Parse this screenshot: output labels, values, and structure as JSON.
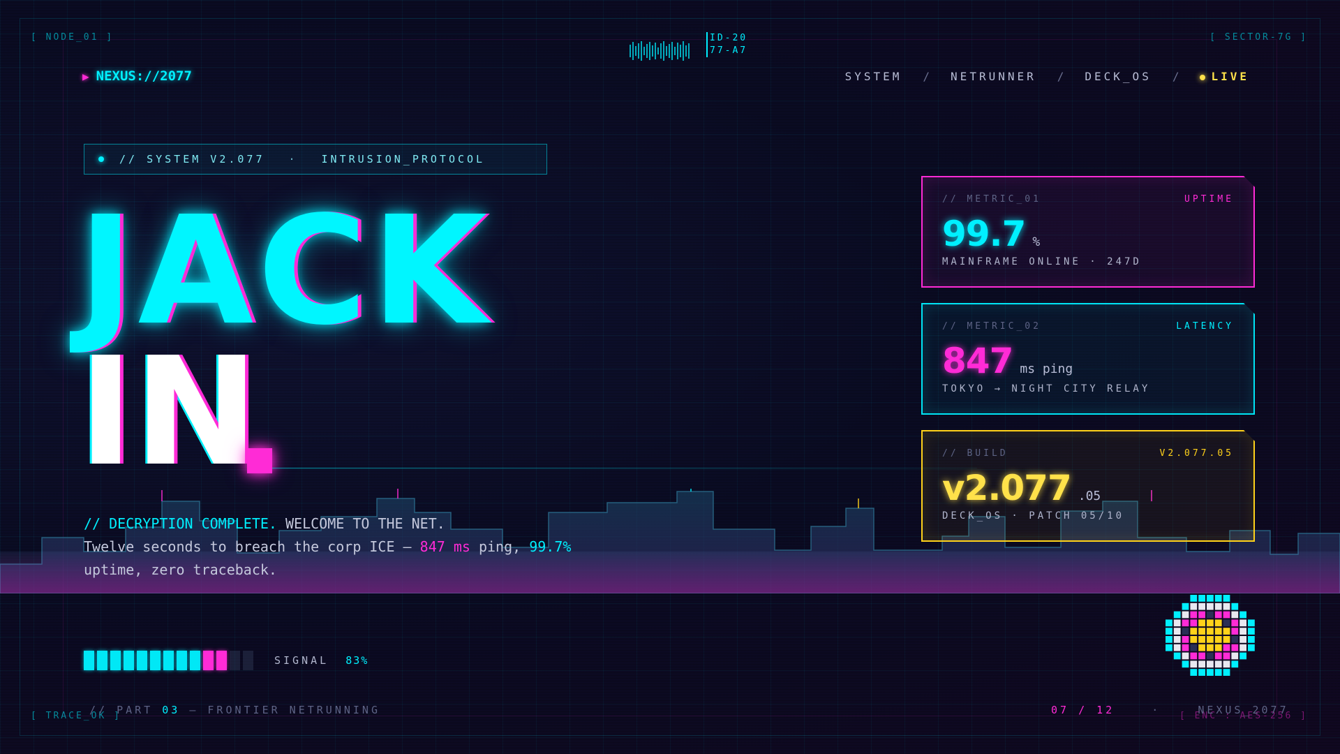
{
  "corners": {
    "top_left": "[ NODE_01 ]",
    "top_right": "[ SECTOR-7G ]",
    "bottom_left": "[ TRACE_OK ]",
    "bottom_right": "[ ENC : AES-256 ]"
  },
  "header": {
    "barcode_id": "ID-2077-A7",
    "brand": "NEXUS://2077",
    "nav": [
      "SYSTEM",
      "NETRUNNER",
      "DECK_OS"
    ],
    "nav_separator": "/",
    "live": "LIVE"
  },
  "tagline": {
    "left": "// SYSTEM V2.077",
    "separator": "·",
    "right": "INTRUSION_PROTOCOL"
  },
  "hero": {
    "line1": "JACK",
    "line2": "IN"
  },
  "description": {
    "lead": "// DECRYPTION COMPLETE.",
    "lead_rest": "WELCOME TO THE NET.",
    "body_pre": "Twelve seconds to breach the corp ICE —",
    "ping": "847 ms",
    "body_mid": "ping,",
    "uptime": "99.7%",
    "body_post": "uptime, zero traceback."
  },
  "metrics": [
    {
      "key": "// METRIC_01",
      "tag": "UPTIME",
      "value": "99.7",
      "unit": "%",
      "sub": "MAINFRAME ONLINE · 247D"
    },
    {
      "key": "// METRIC_02",
      "tag": "LATENCY",
      "value": "847",
      "unit": "ms ping",
      "sub": "TOKYO → NIGHT CITY RELAY"
    },
    {
      "key": "// BUILD",
      "tag": "V2.077.05",
      "value": "v2.077",
      "unit": ".05",
      "sub": "DECK_OS · PATCH 05/10"
    }
  ],
  "signal": {
    "label": "SIGNAL",
    "percent": "83%",
    "segments": {
      "cyan": 9,
      "magenta": 2,
      "off": 2
    }
  },
  "footer": {
    "left_prefix": "// PART",
    "part_number": "03",
    "left_suffix": "— FRONTIER NETRUNNING",
    "page": "07 / 12",
    "separator": "·",
    "right": "NEXUS_2077"
  },
  "colors": {
    "cyan": "#00f0ff",
    "magenta": "#ff2bd6",
    "yellow": "#ffe14a",
    "background": "#0a0b22"
  }
}
